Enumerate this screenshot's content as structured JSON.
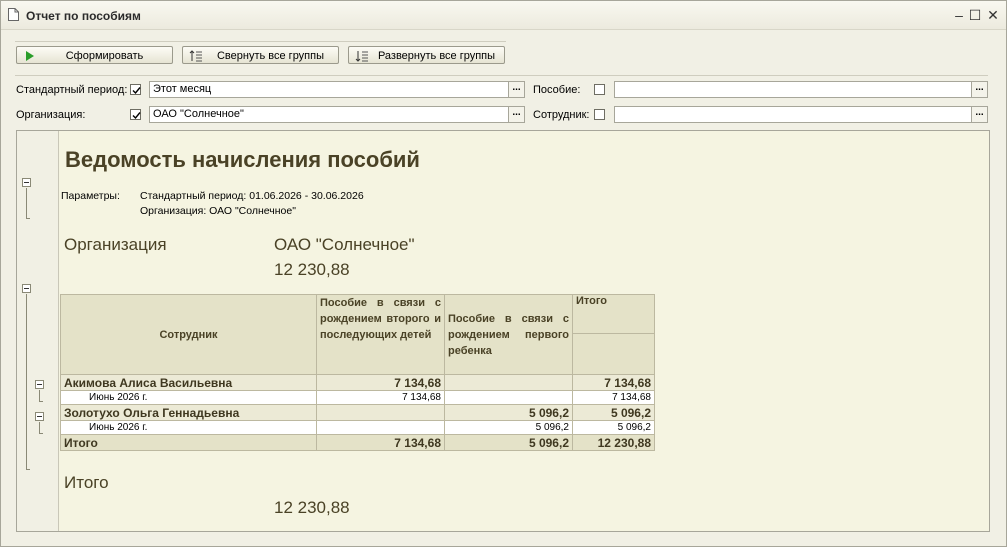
{
  "window": {
    "title": "Отчет по пособиям"
  },
  "toolbar": {
    "generate_label": "Сформировать",
    "collapse_label": "Свернуть все группы",
    "expand_label": "Развернуть все группы"
  },
  "filters": {
    "period_label": "Стандартный период:",
    "period_value": "Этот месяц",
    "period_checked": true,
    "org_label": "Организация:",
    "org_value": "ОАО \"Солнечное\"",
    "org_checked": true,
    "benefit_label": "Пособие:",
    "benefit_value": "",
    "benefit_checked": false,
    "employee_label": "Сотрудник:",
    "employee_value": "",
    "employee_checked": false,
    "ellipsis": "..."
  },
  "report": {
    "title": "Ведомость начисления пособий",
    "params_label": "Параметры:",
    "param_period": "Стандартный период: 01.06.2026 - 30.06.2026",
    "param_org": "Организация: ОАО \"Солнечное\"",
    "org_heading": "Организация",
    "org_name": "ОАО \"Солнечное\"",
    "org_total": "12 230,88",
    "columns": {
      "employee": "Сотрудник",
      "second_child": "Пособие в связи с рождением второго и последующих детей",
      "first_child": "Пособие в связи с рождением первого ребенка",
      "total": "Итого"
    },
    "rows": [
      {
        "name": "Акимова Алиса Васильевна",
        "second": "7 134,68",
        "first": "",
        "total": "7 134,68",
        "detail": {
          "period": "Июнь 2026 г.",
          "second": "7 134,68",
          "first": "",
          "total": "7 134,68"
        }
      },
      {
        "name": "Золотухо Ольга Геннадьевна",
        "second": "",
        "first": "5 096,2",
        "total": "5 096,2",
        "detail": {
          "period": "Июнь 2026 г.",
          "second": "",
          "first": "5 096,2",
          "total": "5 096,2"
        }
      }
    ],
    "totals": {
      "label": "Итого",
      "second": "7 134,68",
      "first": "5 096,2",
      "total": "12 230,88"
    },
    "grand_label": "Итого",
    "grand_total": "12 230,88"
  }
}
